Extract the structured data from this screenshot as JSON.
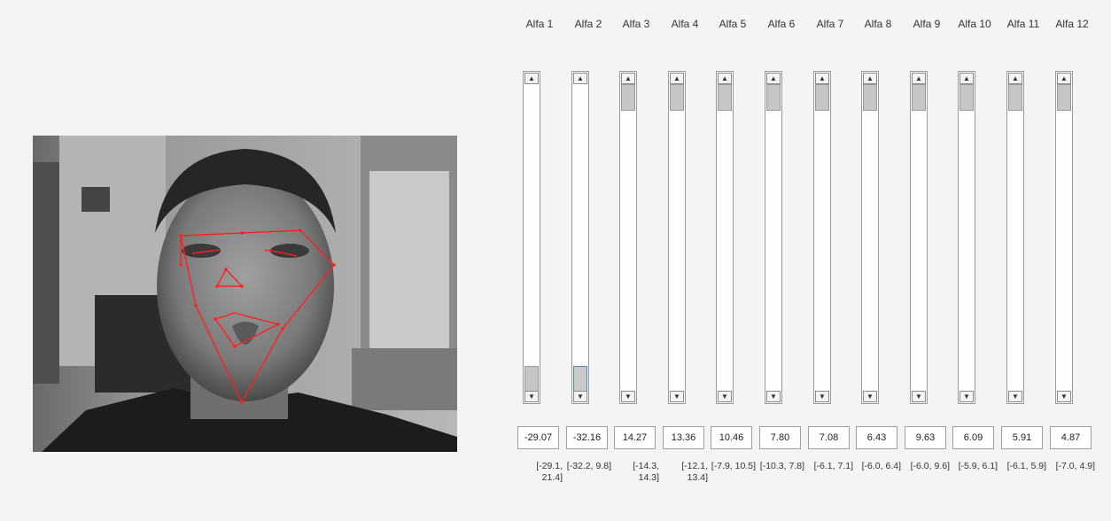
{
  "colors": {
    "background": "#f4f4f4",
    "landmark_line": "#ff2020",
    "thumb": "#c6c6c6",
    "focus_border": "#4f86c6"
  },
  "icons": {
    "up": "▲",
    "down": "▼"
  },
  "alphas": [
    {
      "label": "Alfa 1",
      "value": "-29.07",
      "range": "[-29.1, 21.4]",
      "position": 1.0
    },
    {
      "label": "Alfa 2",
      "value": "-32.16",
      "range": "[-32.2, 9.8]",
      "position": 1.0,
      "focused": true
    },
    {
      "label": "Alfa 3",
      "value": "14.27",
      "range": "[-14.3, 14.3]",
      "position": 0.0
    },
    {
      "label": "Alfa 4",
      "value": "13.36",
      "range": "[-12.1, 13.4]",
      "position": 0.0
    },
    {
      "label": "Alfa 5",
      "value": "10.46",
      "range": "[-7.9, 10.5]",
      "position": 0.0
    },
    {
      "label": "Alfa 6",
      "value": "7.80",
      "range": "[-10.3, 7.8]",
      "position": 0.0
    },
    {
      "label": "Alfa 7",
      "value": "7.08",
      "range": "[-6.1, 7.1]",
      "position": 0.0
    },
    {
      "label": "Alfa 8",
      "value": "6.43",
      "range": "[-6.0, 6.4]",
      "position": 0.0
    },
    {
      "label": "Alfa 9",
      "value": "9.63",
      "range": "[-6.0, 9.6]",
      "position": 0.0
    },
    {
      "label": "Alfa 10",
      "value": "6.09",
      "range": "[-5.9, 6.1]",
      "position": 0.0
    },
    {
      "label": "Alfa 11",
      "value": "5.91",
      "range": "[-6.1, 5.9]",
      "position": 0.0
    },
    {
      "label": "Alfa 12",
      "value": "4.87",
      "range": "[-7.0, 4.9]",
      "position": 0.0
    }
  ]
}
